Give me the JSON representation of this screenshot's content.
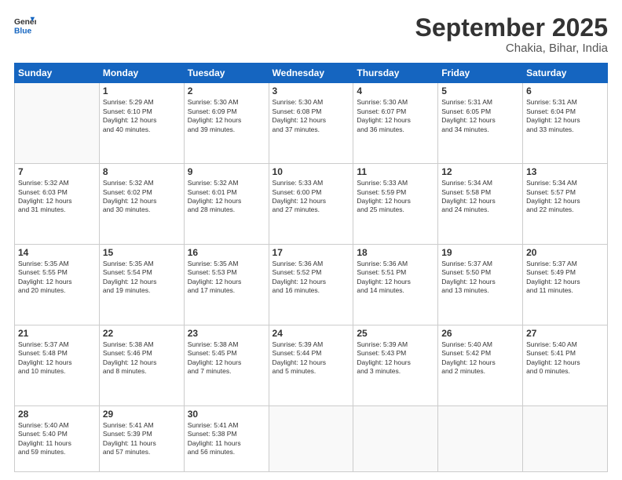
{
  "header": {
    "logo_line1": "General",
    "logo_line2": "Blue",
    "month": "September 2025",
    "location": "Chakia, Bihar, India"
  },
  "weekdays": [
    "Sunday",
    "Monday",
    "Tuesday",
    "Wednesday",
    "Thursday",
    "Friday",
    "Saturday"
  ],
  "weeks": [
    [
      {
        "day": "",
        "text": ""
      },
      {
        "day": "1",
        "text": "Sunrise: 5:29 AM\nSunset: 6:10 PM\nDaylight: 12 hours\nand 40 minutes."
      },
      {
        "day": "2",
        "text": "Sunrise: 5:30 AM\nSunset: 6:09 PM\nDaylight: 12 hours\nand 39 minutes."
      },
      {
        "day": "3",
        "text": "Sunrise: 5:30 AM\nSunset: 6:08 PM\nDaylight: 12 hours\nand 37 minutes."
      },
      {
        "day": "4",
        "text": "Sunrise: 5:30 AM\nSunset: 6:07 PM\nDaylight: 12 hours\nand 36 minutes."
      },
      {
        "day": "5",
        "text": "Sunrise: 5:31 AM\nSunset: 6:05 PM\nDaylight: 12 hours\nand 34 minutes."
      },
      {
        "day": "6",
        "text": "Sunrise: 5:31 AM\nSunset: 6:04 PM\nDaylight: 12 hours\nand 33 minutes."
      }
    ],
    [
      {
        "day": "7",
        "text": "Sunrise: 5:32 AM\nSunset: 6:03 PM\nDaylight: 12 hours\nand 31 minutes."
      },
      {
        "day": "8",
        "text": "Sunrise: 5:32 AM\nSunset: 6:02 PM\nDaylight: 12 hours\nand 30 minutes."
      },
      {
        "day": "9",
        "text": "Sunrise: 5:32 AM\nSunset: 6:01 PM\nDaylight: 12 hours\nand 28 minutes."
      },
      {
        "day": "10",
        "text": "Sunrise: 5:33 AM\nSunset: 6:00 PM\nDaylight: 12 hours\nand 27 minutes."
      },
      {
        "day": "11",
        "text": "Sunrise: 5:33 AM\nSunset: 5:59 PM\nDaylight: 12 hours\nand 25 minutes."
      },
      {
        "day": "12",
        "text": "Sunrise: 5:34 AM\nSunset: 5:58 PM\nDaylight: 12 hours\nand 24 minutes."
      },
      {
        "day": "13",
        "text": "Sunrise: 5:34 AM\nSunset: 5:57 PM\nDaylight: 12 hours\nand 22 minutes."
      }
    ],
    [
      {
        "day": "14",
        "text": "Sunrise: 5:35 AM\nSunset: 5:55 PM\nDaylight: 12 hours\nand 20 minutes."
      },
      {
        "day": "15",
        "text": "Sunrise: 5:35 AM\nSunset: 5:54 PM\nDaylight: 12 hours\nand 19 minutes."
      },
      {
        "day": "16",
        "text": "Sunrise: 5:35 AM\nSunset: 5:53 PM\nDaylight: 12 hours\nand 17 minutes."
      },
      {
        "day": "17",
        "text": "Sunrise: 5:36 AM\nSunset: 5:52 PM\nDaylight: 12 hours\nand 16 minutes."
      },
      {
        "day": "18",
        "text": "Sunrise: 5:36 AM\nSunset: 5:51 PM\nDaylight: 12 hours\nand 14 minutes."
      },
      {
        "day": "19",
        "text": "Sunrise: 5:37 AM\nSunset: 5:50 PM\nDaylight: 12 hours\nand 13 minutes."
      },
      {
        "day": "20",
        "text": "Sunrise: 5:37 AM\nSunset: 5:49 PM\nDaylight: 12 hours\nand 11 minutes."
      }
    ],
    [
      {
        "day": "21",
        "text": "Sunrise: 5:37 AM\nSunset: 5:48 PM\nDaylight: 12 hours\nand 10 minutes."
      },
      {
        "day": "22",
        "text": "Sunrise: 5:38 AM\nSunset: 5:46 PM\nDaylight: 12 hours\nand 8 minutes."
      },
      {
        "day": "23",
        "text": "Sunrise: 5:38 AM\nSunset: 5:45 PM\nDaylight: 12 hours\nand 7 minutes."
      },
      {
        "day": "24",
        "text": "Sunrise: 5:39 AM\nSunset: 5:44 PM\nDaylight: 12 hours\nand 5 minutes."
      },
      {
        "day": "25",
        "text": "Sunrise: 5:39 AM\nSunset: 5:43 PM\nDaylight: 12 hours\nand 3 minutes."
      },
      {
        "day": "26",
        "text": "Sunrise: 5:40 AM\nSunset: 5:42 PM\nDaylight: 12 hours\nand 2 minutes."
      },
      {
        "day": "27",
        "text": "Sunrise: 5:40 AM\nSunset: 5:41 PM\nDaylight: 12 hours\nand 0 minutes."
      }
    ],
    [
      {
        "day": "28",
        "text": "Sunrise: 5:40 AM\nSunset: 5:40 PM\nDaylight: 11 hours\nand 59 minutes."
      },
      {
        "day": "29",
        "text": "Sunrise: 5:41 AM\nSunset: 5:39 PM\nDaylight: 11 hours\nand 57 minutes."
      },
      {
        "day": "30",
        "text": "Sunrise: 5:41 AM\nSunset: 5:38 PM\nDaylight: 11 hours\nand 56 minutes."
      },
      {
        "day": "",
        "text": ""
      },
      {
        "day": "",
        "text": ""
      },
      {
        "day": "",
        "text": ""
      },
      {
        "day": "",
        "text": ""
      }
    ]
  ]
}
